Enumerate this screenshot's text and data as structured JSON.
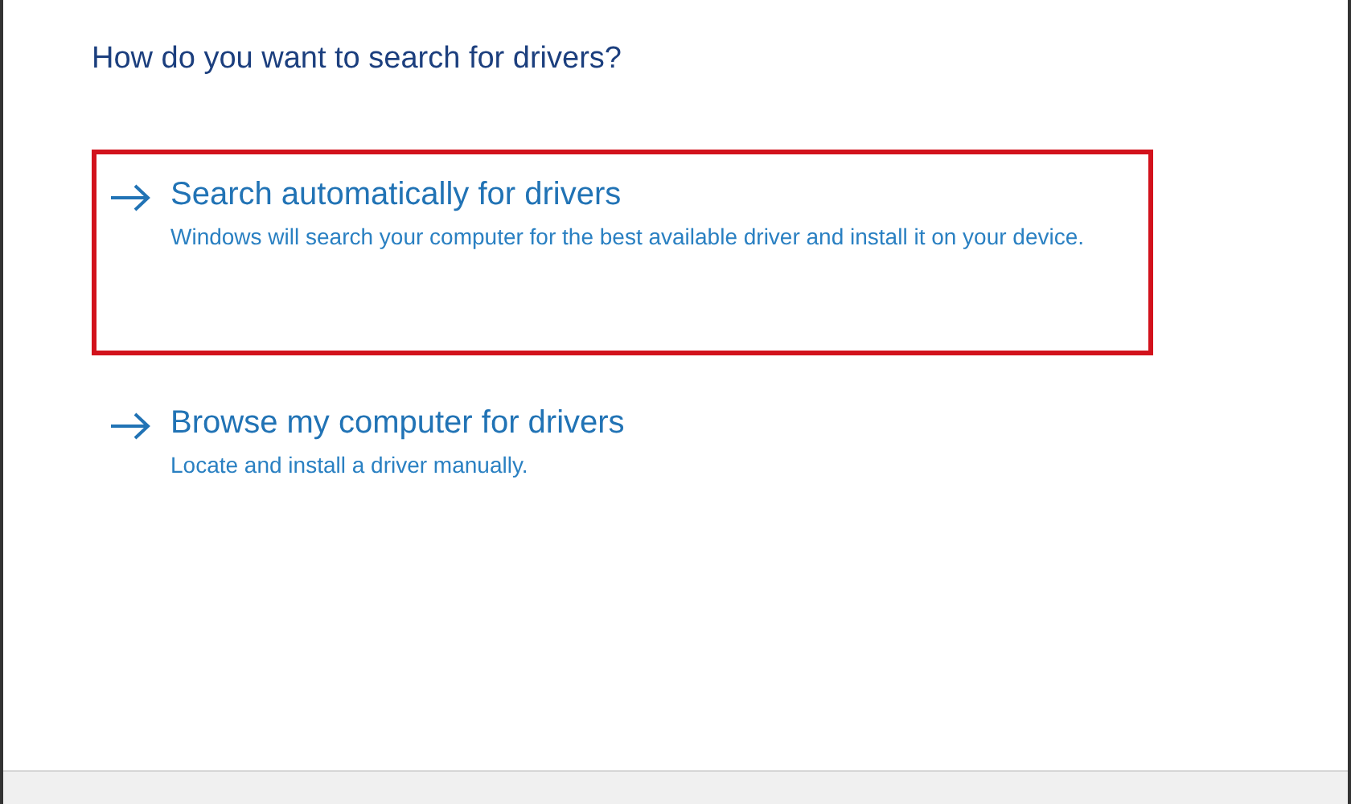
{
  "heading": "How do you want to search for drivers?",
  "options": [
    {
      "title": "Search automatically for drivers",
      "description": "Windows will search your computer for the best available driver and install it on your device.",
      "highlighted": true
    },
    {
      "title": "Browse my computer for drivers",
      "description": "Locate and install a driver manually.",
      "highlighted": false
    }
  ]
}
